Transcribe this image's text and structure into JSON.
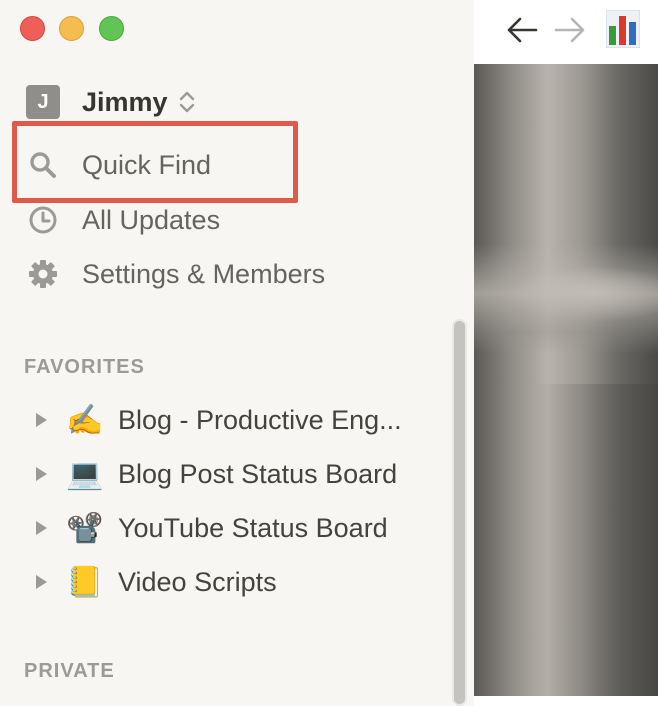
{
  "window": {
    "buttons": [
      "close",
      "minimize",
      "zoom"
    ]
  },
  "workspace": {
    "avatar_letter": "J",
    "name": "Jimmy",
    "switch_icon": "chevron-updown-icon"
  },
  "nav": [
    {
      "label": "Quick Find",
      "icon": "search-icon",
      "highlighted": true
    },
    {
      "label": "All Updates",
      "icon": "clock-icon"
    },
    {
      "label": "Settings & Members",
      "icon": "gear-icon"
    }
  ],
  "sections": {
    "favorites": "FAVORITES",
    "private": "PRIVATE"
  },
  "favorites": [
    {
      "label": "Blog - Productive Eng...",
      "emoji": "✍️",
      "icon": "writing-hand-icon"
    },
    {
      "label": "Blog Post Status Board",
      "emoji": "💻",
      "icon": "laptop-icon"
    },
    {
      "label": "YouTube Status Board",
      "emoji": "📽️",
      "icon": "film-projector-icon"
    },
    {
      "label": "Video Scripts",
      "emoji": "📒",
      "icon": "notebook-icon"
    }
  ],
  "toolbar": {
    "back_icon": "arrow-left-icon",
    "forward_icon": "arrow-right-icon",
    "page_icon": "bar-chart-icon"
  },
  "colors": {
    "sidebar_bg": "#f7f6f3",
    "highlight_border": "#e05a4a",
    "text": "#37352f",
    "muted_text": "#9b9a97"
  }
}
